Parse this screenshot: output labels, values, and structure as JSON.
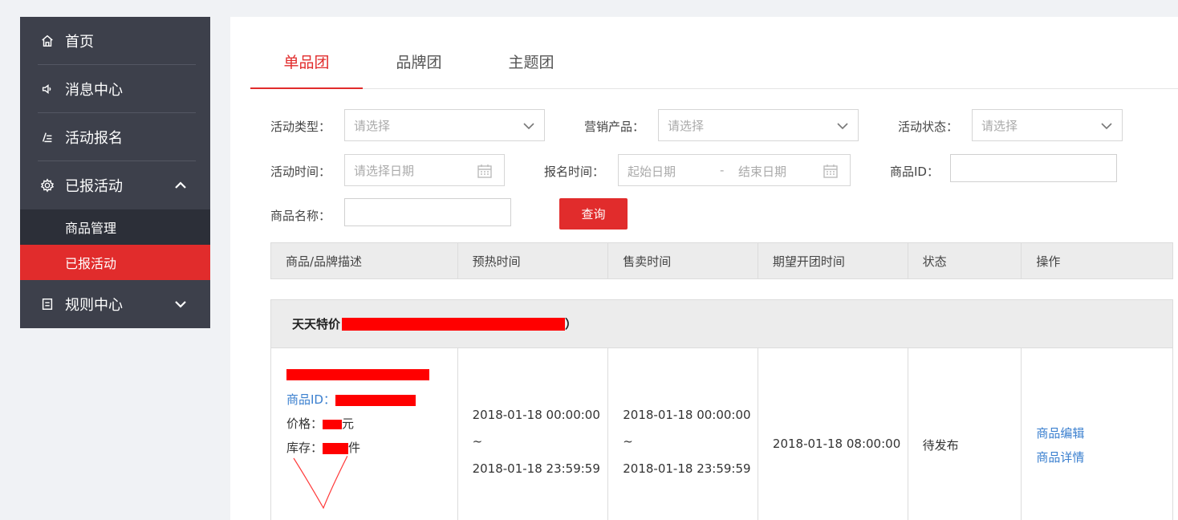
{
  "sidebar": {
    "items": [
      {
        "label": "首页",
        "icon": "home-icon"
      },
      {
        "label": "消息中心",
        "icon": "speaker-icon"
      },
      {
        "label": "活动报名",
        "icon": "edit-list-icon"
      },
      {
        "label": "已报活动",
        "icon": "gear-icon",
        "expanded": true
      },
      {
        "label": "规则中心",
        "icon": "document-icon",
        "expanded": false
      }
    ],
    "subitems": [
      {
        "label": "商品管理"
      },
      {
        "label": "已报活动",
        "active": true
      }
    ]
  },
  "tabs": [
    {
      "label": "单品团",
      "active": true
    },
    {
      "label": "品牌团"
    },
    {
      "label": "主题团"
    }
  ],
  "filters": {
    "activity_type": {
      "label": "活动类型：",
      "placeholder": "请选择"
    },
    "marketing_product": {
      "label": "营销产品：",
      "placeholder": "请选择"
    },
    "activity_status": {
      "label": "活动状态：",
      "placeholder": "请选择"
    },
    "activity_time": {
      "label": "活动时间：",
      "placeholder": "请选择日期"
    },
    "signup_time": {
      "label": "报名时间：",
      "start_placeholder": "起始日期",
      "separator": "-",
      "end_placeholder": "结束日期"
    },
    "product_id": {
      "label": "商品ID："
    },
    "product_name": {
      "label": "商品名称："
    },
    "query_button": "查询"
  },
  "table": {
    "columns": [
      "商品/品牌描述",
      "预热时间",
      "售卖时间",
      "期望开团时间",
      "状态",
      "操作"
    ],
    "group_title": "天天特价",
    "group_title_suffix": "）",
    "rows": [
      {
        "id_label": "商品ID：",
        "price_label": "价格：",
        "price_unit": "元",
        "stock_label": "库存：",
        "stock_unit": "件",
        "preheat_start": "2018-01-18 00:00:00",
        "preheat_sep": "~",
        "preheat_end": "2018-01-18 23:59:59",
        "sale_start": "2018-01-18 00:00:00",
        "sale_sep": "~",
        "sale_end": "2018-01-18 23:59:59",
        "expected_open": "2018-01-18 08:00:00",
        "status": "待发布",
        "actions": [
          "商品编辑",
          "商品详情"
        ]
      }
    ]
  },
  "colors": {
    "accent": "#e12c2c",
    "sidebar_bg": "#3d404b",
    "link": "#3a7fcf",
    "redaction": "#ff0000"
  }
}
